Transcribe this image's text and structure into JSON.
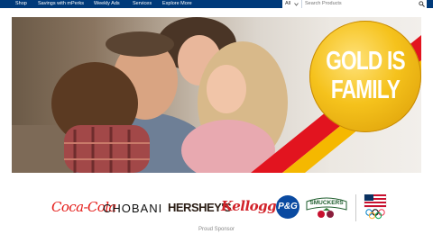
{
  "nav": {
    "items": [
      "Shop",
      "Savings with mPerks",
      "Weekly Ads",
      "Services",
      "Explore More"
    ],
    "search_scope": "All",
    "search_placeholder": "Search Products",
    "bar_color": "#003a7a"
  },
  "hero": {
    "headline_line1": "GOLD IS",
    "headline_line2": "FAMILY",
    "medal_color": "#f5c21c",
    "ribbon_colors": [
      "#e2141f",
      "#f5b800"
    ]
  },
  "sponsors": {
    "logos": [
      "Coca-Cola",
      "CHOBANI",
      "HERSHEY'S",
      "Kellogg's",
      "P&G",
      "SMUCKERS",
      "Team USA"
    ],
    "caption": "Proud Sponsor"
  },
  "icons": {
    "search": "search-icon",
    "dropdown": "chevron-down-icon"
  }
}
